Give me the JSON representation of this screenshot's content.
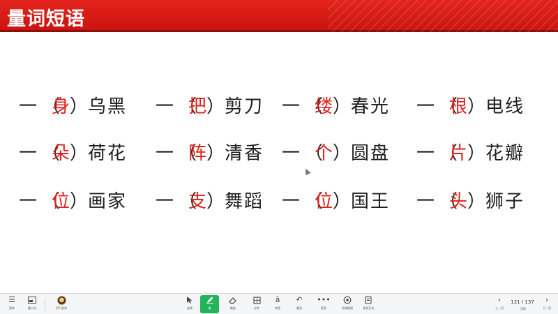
{
  "slide": {
    "title": "量词短语",
    "rows": [
      [
        {
          "one": "一",
          "open": "（",
          "measure": "身",
          "close": "）",
          "noun": "乌黑"
        },
        {
          "one": "一",
          "open": "（",
          "measure": "把",
          "close": "）",
          "noun": "剪刀"
        },
        {
          "one": "一",
          "open": "（",
          "measure": "缕",
          "close": "）",
          "noun": "春光"
        },
        {
          "one": "一",
          "open": "（",
          "measure": "根",
          "close": "）",
          "noun": "电线"
        }
      ],
      [
        {
          "one": "一",
          "open": "（",
          "measure": "朵",
          "close": "）",
          "noun": "荷花"
        },
        {
          "one": "一",
          "open": "（",
          "measure": "阵",
          "close": "）",
          "noun": "清香"
        },
        {
          "one": "一",
          "open": "（",
          "measure": "个",
          "close": "）",
          "noun": "圆盘"
        },
        {
          "one": "一",
          "open": "（",
          "measure": "片",
          "close": "）",
          "noun": "花瓣"
        }
      ],
      [
        {
          "one": "一",
          "open": "（",
          "measure": "位",
          "close": "）",
          "noun": "画家"
        },
        {
          "one": "一",
          "open": "（",
          "measure": "支",
          "close": "）",
          "noun": "舞蹈"
        },
        {
          "one": "一",
          "open": "（",
          "measure": "位",
          "close": "）",
          "noun": "国王"
        },
        {
          "one": "一",
          "open": "（",
          "measure": "头",
          "close": "）",
          "noun": "狮子"
        }
      ]
    ]
  },
  "colors": {
    "title_bar": "#d71b14",
    "answer_text": "#e0201a",
    "pen_active": "#22b45a"
  },
  "toolbar": {
    "left": [
      {
        "icon": "menu-icon",
        "label": "菜单"
      },
      {
        "icon": "minimize-icon",
        "label": "最小化"
      },
      {
        "icon": "avatar-icon",
        "label": "阿气老师"
      }
    ],
    "center": [
      {
        "icon": "cursor-arrow-icon",
        "label": "选择"
      },
      {
        "icon": "pen-icon",
        "label": "笔",
        "active": true
      },
      {
        "icon": "eraser-icon",
        "label": "橡皮"
      },
      {
        "icon": "crop-icon",
        "label": "汉字"
      },
      {
        "icon": "magnifier-icon",
        "label": "拼音"
      },
      {
        "icon": "undo-icon",
        "label": "撤消"
      },
      {
        "icon": "more-icon",
        "label": "更多"
      },
      {
        "icon": "screen-record-icon",
        "label": "授课助理"
      },
      {
        "icon": "multiscreen-icon",
        "label": "多屏互动"
      }
    ],
    "right": {
      "prev_label": "上一页",
      "page_label": "页码",
      "next_label": "下一页",
      "page_indicator": "121 / 137"
    }
  }
}
